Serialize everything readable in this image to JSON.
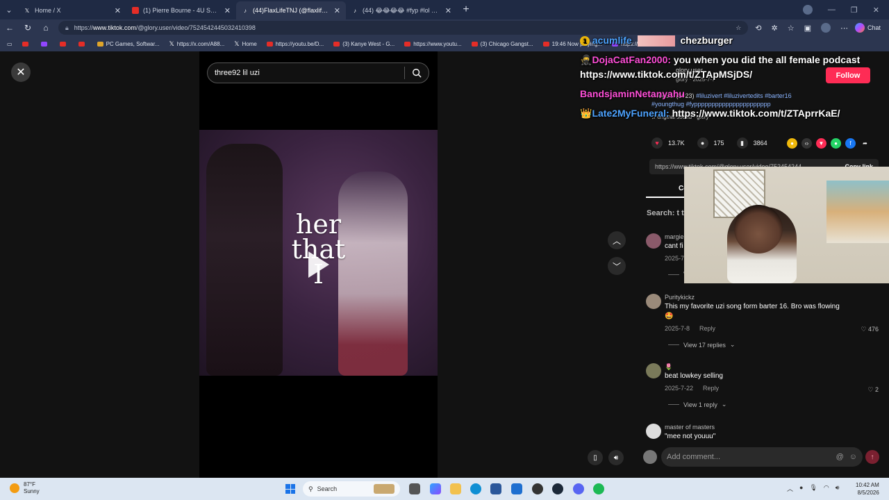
{
  "browser": {
    "tabs": [
      {
        "title": "Home / X",
        "active": false
      },
      {
        "title": "(1) Pierre Bourne - 4U Snippet | 💚",
        "active": false
      },
      {
        "title": "(44)FlaxLifeTNJ (@flaxlifetnj) | TikTok",
        "active": true
      },
      {
        "title": "(44) 😂😂😂😂 #fyp #lol #oota #",
        "active": false
      }
    ],
    "url_prefix": "https://",
    "url_host": "www.tiktok.com",
    "url_path": "/@glory.user/video/7524542445032410398",
    "chat_label": "Chat",
    "bookmarks": [
      {
        "label": "",
        "type": "yt"
      },
      {
        "label": "",
        "type": "tw"
      },
      {
        "label": "",
        "type": "yt"
      },
      {
        "label": "",
        "type": "yt"
      },
      {
        "label": "PC Games, Softwar...",
        "type": "gm"
      },
      {
        "label": "https://x.com/A88...",
        "type": "x"
      },
      {
        "label": "Home",
        "type": "x"
      },
      {
        "label": "https://youtu.be/D...",
        "type": "yt"
      },
      {
        "label": "(3) Kanye West - G...",
        "type": "yt"
      },
      {
        "label": "https://www.youtu...",
        "type": "yt"
      },
      {
        "label": "(3) Chicago Gangst...",
        "type": "yt"
      },
      {
        "label": "19:46 Now playing...",
        "type": "yt"
      },
      {
        "label": "https://www.twitch...",
        "type": "tw"
      }
    ]
  },
  "player": {
    "search_query": "three92 lil uzi",
    "overlay_text_line1": "her",
    "overlay_text_line2": "that",
    "overlay_text_line3": "I"
  },
  "post": {
    "author": "glory.user",
    "author_sub": "glory · 2025-7-7",
    "follow_label": "Follow",
    "desc_prefix": "three92. (2023)",
    "hashtags_1": "#liluzivert #liluzivertedits #barter16",
    "hashtags_2": "#youngthug #fypppppppppppppppppppppp",
    "sound": "♫ original sound - glory",
    "likes": "13.7K",
    "comments": "175",
    "saves": "3864",
    "link": "https://www.tiktok.com/@glory.user/video/752454244...",
    "copy_link": "Copy link",
    "comments_tab": "Co",
    "search_hint": "Search: t ti"
  },
  "comments": [
    {
      "user": "margie",
      "text": "cant fi",
      "date": "2025-7",
      "reply": "",
      "likes": "",
      "replies": "V"
    },
    {
      "user": "Puritykickz",
      "text": "This my favorite uzi song form barter 16. Bro was flowing",
      "text2": "🤩",
      "date": "2025-7-8",
      "reply": "Reply",
      "likes": "476",
      "replies": "View 17 replies"
    },
    {
      "user": "🌷",
      "text": "beat lowkey selling",
      "date": "2025-7-22",
      "reply": "Reply",
      "likes": "2",
      "replies": "View 1 reply"
    },
    {
      "user": "master of masters",
      "text": "\"mee not youuu\"",
      "date": "",
      "reply": "",
      "likes": "",
      "replies": ""
    }
  ],
  "add_comment_placeholder": "Add comment...",
  "stream_chat": [
    {
      "user": "acumlife",
      "badge": "1",
      "text": "",
      "color": "#4da3ff",
      "extra": "chezburger"
    },
    {
      "user": "DojaCatFan2000:",
      "text": " you when you did the all female podcast",
      "color": "#ff4fd8"
    },
    {
      "user": "",
      "text": "https://www.tiktok.com/t/ZTApMSjDS/",
      "color": "#ffffff"
    },
    {
      "user": "BandsjaminNetanyahu",
      "text": "",
      "color": "#ff4fd8"
    },
    {
      "user": "Late2MyFuneral:",
      "text": " https://www.tiktok.com/t/ZTAprrKaE/",
      "color": "#4da3ff"
    }
  ],
  "taskbar": {
    "temp": "87°F",
    "cond": "Sunny",
    "search": "Search",
    "time": "10:42 AM",
    "date": "8/5/2026"
  },
  "colors": {
    "accent_follow": "#fe2c55",
    "tiktok_bg": "#121212",
    "taskbar_bg": "#dce6f2"
  }
}
